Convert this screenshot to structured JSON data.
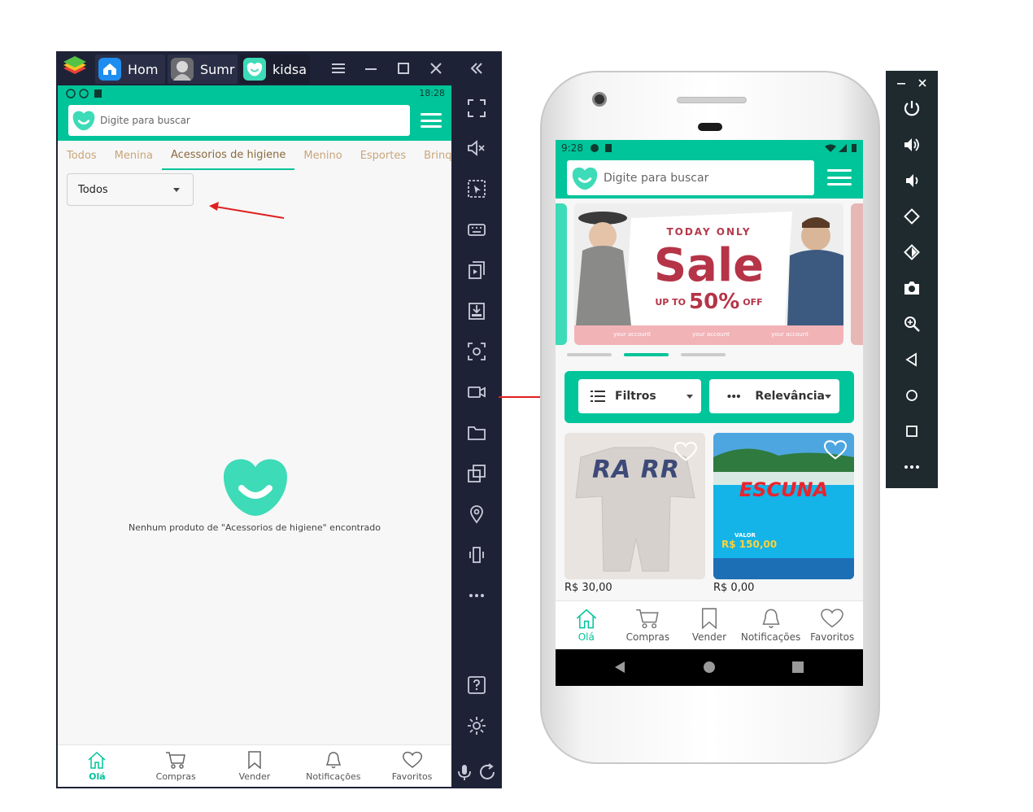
{
  "bluestacks": {
    "tabs": [
      {
        "label": "Hom"
      },
      {
        "label": "Sumr"
      },
      {
        "label": "kidsa"
      }
    ],
    "status_time": "18:28",
    "search_placeholder": "Digite para buscar",
    "category_tabs": [
      {
        "label": "Todos"
      },
      {
        "label": "Menina"
      },
      {
        "label": "Acessorios de higiene"
      },
      {
        "label": "Menino"
      },
      {
        "label": "Esportes"
      },
      {
        "label": "Brinquedo"
      }
    ],
    "filter_select_value": "Todos",
    "empty_message": "Nenhum produto de \"Acessorios de higiene\" encontrado",
    "bottom_nav": [
      {
        "label": "Olá"
      },
      {
        "label": "Compras"
      },
      {
        "label": "Vender"
      },
      {
        "label": "Notificações"
      },
      {
        "label": "Favoritos"
      }
    ]
  },
  "phone": {
    "status_time": "9:28",
    "search_placeholder": "Digite para buscar",
    "banner": {
      "kicker": "TODAY ONLY",
      "headline": "Sale",
      "subline_prefix": "UP TO",
      "percent": "50%",
      "subline_suffix": "OFF",
      "social_text": "your account"
    },
    "filters": {
      "filter_label": "Filtros",
      "sort_label": "Relevância"
    },
    "products": [
      {
        "price": "R$ 30,00",
        "image_text": "RA RR"
      },
      {
        "price": "R$ 0,00",
        "image_text": "ESCUNA",
        "valor_label": "VALOR",
        "valor": "R$ 150,00"
      }
    ],
    "bottom_nav": [
      {
        "label": "Olá"
      },
      {
        "label": "Compras"
      },
      {
        "label": "Vender"
      },
      {
        "label": "Notificações"
      },
      {
        "label": "Favoritos"
      }
    ]
  },
  "colors": {
    "brand": "#00c49a",
    "host_bg": "#1e2236",
    "arrow": "#e02020"
  }
}
